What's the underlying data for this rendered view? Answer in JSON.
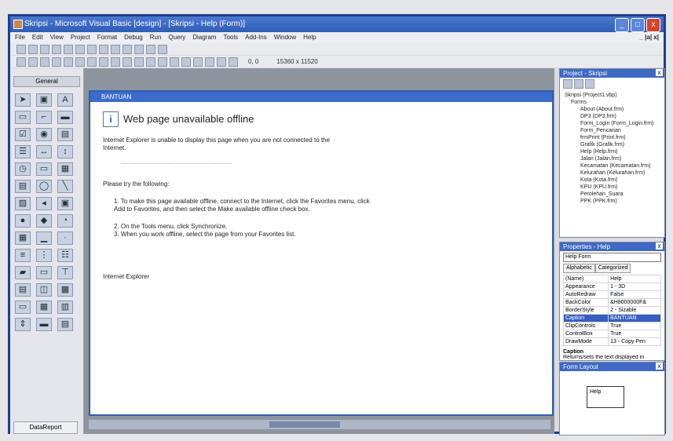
{
  "window": {
    "title": "Skripsi - Microsoft Visual Basic [design] - [Skripsi - Help (Form)]",
    "min": "_",
    "max": "□",
    "close": "x"
  },
  "menu": [
    "File",
    "Edit",
    "View",
    "Project",
    "Format",
    "Debug",
    "Run",
    "Query",
    "Diagram",
    "Tools",
    "Add-Ins",
    "Window",
    "Help"
  ],
  "menu_right": "_ |a| x|",
  "toolbar": {
    "coords": "0, 0",
    "size": "15360 x 11520"
  },
  "toolbox": {
    "header": "General",
    "footer": "DataReport"
  },
  "child": {
    "title": "BANTUAN",
    "heading": "Web page unavailable offline",
    "desc": "Internet Explorer is unable to display this page when you are not connected to the Internet.",
    "try": "Please try the following:",
    "step1_num": "1.",
    "step1": "To make this page available offline, connect to the Internet, click the Favorites menu, click Add to Favorites, and then select the Make available offline check box.",
    "step2_num": "2.",
    "step2": "On the Tools menu, click Synchronize.",
    "step3_num": "3.",
    "step3": "When you work offline, select the page from your Favorites list.",
    "footer": "Internet Explorer"
  },
  "project": {
    "title": "Project - Skripsi",
    "root": "Skripsi (Project1.vbp)",
    "folder": "Forms",
    "items": [
      "About (About.frm)",
      "DP3 (DP3.frm)",
      "Form_Login (Form_Login.frm)",
      "Form_Pencarian",
      "frmPrint (Print.frm)",
      "Grafik (Grafik.frm)",
      "Help (Help.frm)",
      "Jalan (Jalan.frm)",
      "Kecamatan (Kecamatan.frm)",
      "Kelurahan (Kelurahan.frm)",
      "Kota (Kota.frm)",
      "KPU (KPU.frm)",
      "Perolehan_Suara",
      "PPK (PPK.frm)"
    ]
  },
  "properties": {
    "title": "Properties - Help",
    "combo": "Help Form",
    "tabs": [
      "Alphabetic",
      "Categorized"
    ],
    "rows": [
      [
        "(Name)",
        "Help"
      ],
      [
        "Appearance",
        "1 - 3D"
      ],
      [
        "AutoRedraw",
        "False"
      ],
      [
        "BackColor",
        "&H8000000F&"
      ],
      [
        "BorderStyle",
        "2 - Sizable"
      ],
      [
        "Caption",
        "BANTUAN"
      ],
      [
        "ClipControls",
        "True"
      ],
      [
        "ControlBox",
        "True"
      ],
      [
        "DrawMode",
        "13 - Copy Pen"
      ]
    ],
    "desc_title": "Caption",
    "desc_text": "Returns/sets the text displayed in"
  },
  "layout": {
    "title": "Form Layout",
    "form_label": "Help"
  }
}
